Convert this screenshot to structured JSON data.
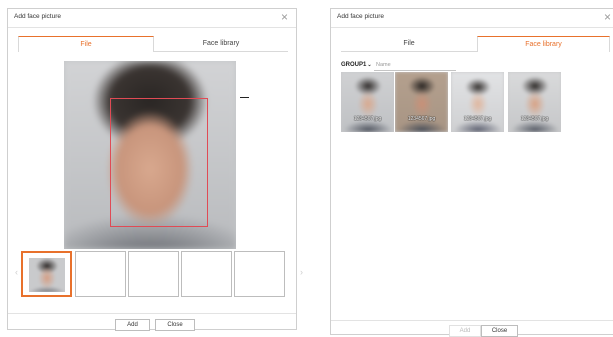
{
  "left_dialog": {
    "title": "Add face picture",
    "close_glyph": "×",
    "tabs": [
      {
        "label": "File",
        "active": true
      },
      {
        "label": "Face library",
        "active": false
      }
    ],
    "preview_icon": "face-photo",
    "thumbnails": [
      {
        "filled": true,
        "selected": true
      },
      {
        "filled": false,
        "selected": false
      },
      {
        "filled": false,
        "selected": false
      },
      {
        "filled": false,
        "selected": false
      },
      {
        "filled": false,
        "selected": false
      }
    ],
    "arrow_left": "‹",
    "arrow_right": "›",
    "buttons": {
      "add": "Add",
      "close": "Close"
    }
  },
  "right_dialog": {
    "title": "Add face picture",
    "close_glyph": "×",
    "tabs": [
      {
        "label": "File",
        "active": false
      },
      {
        "label": "Face library",
        "active": true
      }
    ],
    "group_select": "GROUP1",
    "group_chevron": "⌄",
    "name_placeholder": "Name",
    "library_items": [
      {
        "name": "1234567.jpg"
      },
      {
        "name": "1234567.jpg"
      },
      {
        "name": "1234567.jpg"
      },
      {
        "name": "1234567.jpg"
      }
    ],
    "buttons": {
      "add": "Add",
      "close": "Close",
      "add_disabled": true
    }
  },
  "colors": {
    "accent": "#e8712c",
    "face_box": "#e04b55",
    "border": "#cfcfcf"
  }
}
